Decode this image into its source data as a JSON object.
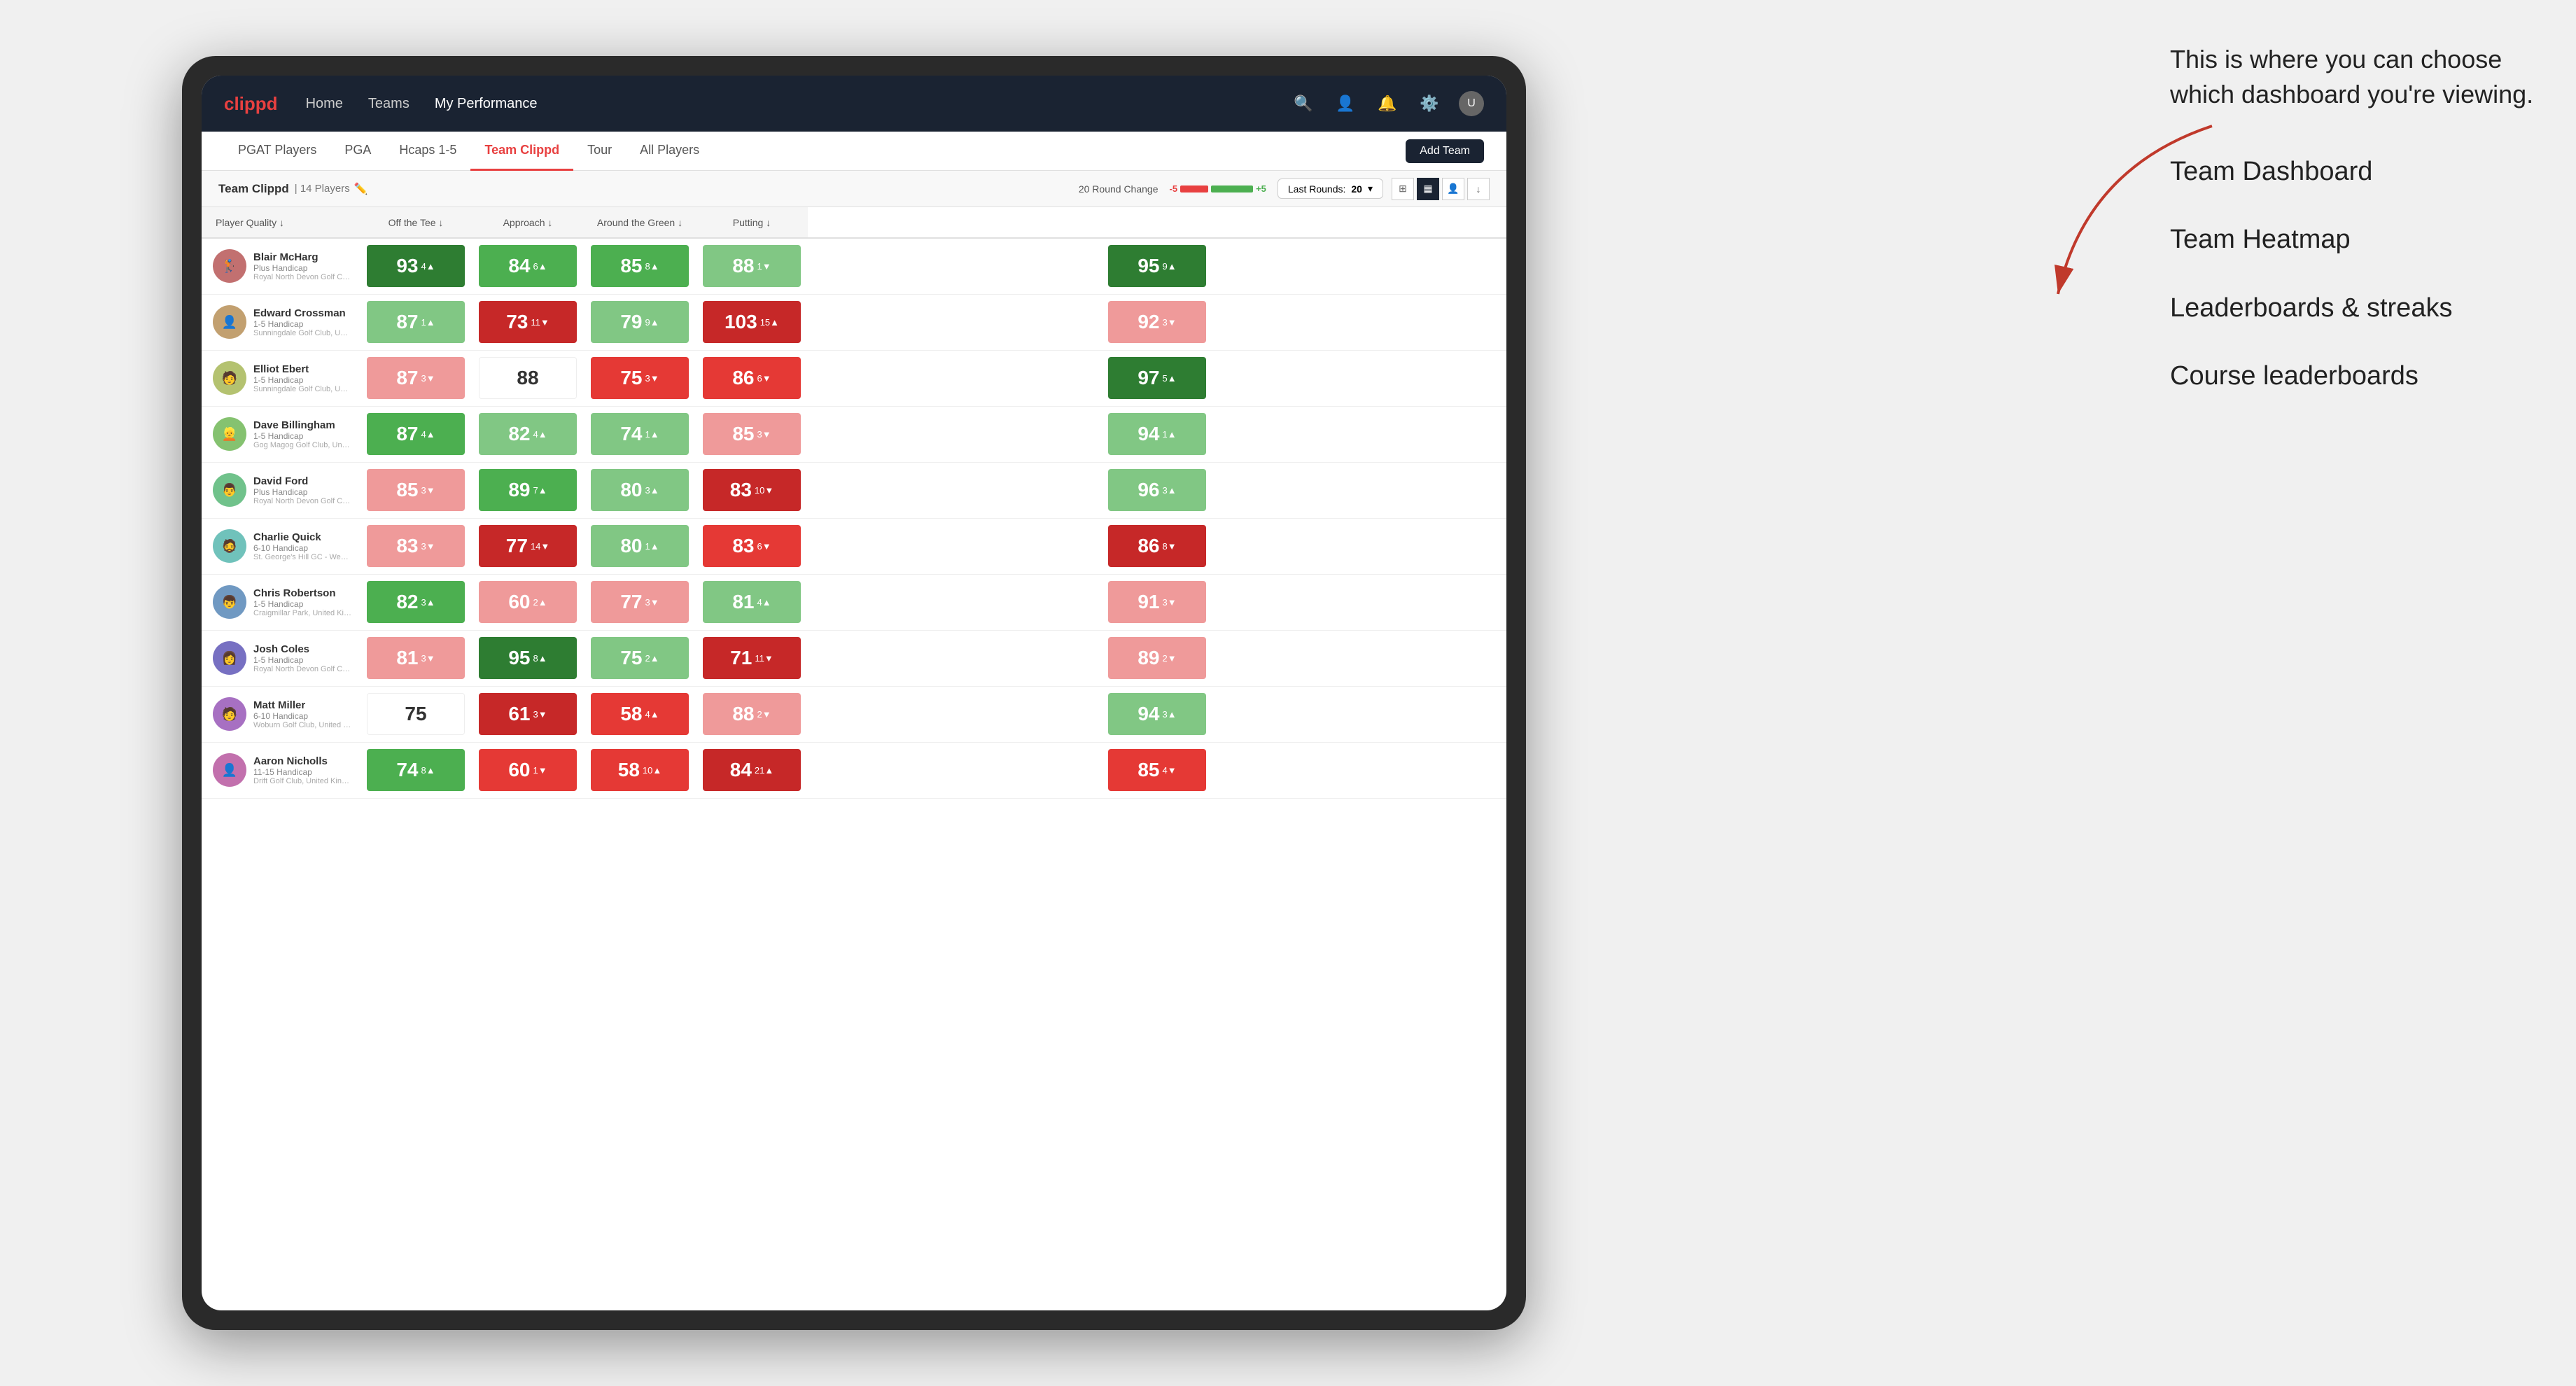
{
  "annotation": {
    "intro": "This is where you can choose which dashboard you're viewing.",
    "menu_items": [
      "Team Dashboard",
      "Team Heatmap",
      "Leaderboards & streaks",
      "Course leaderboards"
    ]
  },
  "nav": {
    "logo": "clippd",
    "items": [
      "Home",
      "Teams",
      "My Performance"
    ],
    "active": "My Performance"
  },
  "sub_nav": {
    "items": [
      "PGAT Players",
      "PGA",
      "Hcaps 1-5",
      "Team Clippd",
      "Tour",
      "All Players"
    ],
    "active": "Team Clippd",
    "add_team": "Add Team"
  },
  "team_header": {
    "title": "Team Clippd",
    "separator": "|",
    "count": "14 Players",
    "round_change_label": "20 Round Change",
    "round_neg": "-5",
    "round_pos": "+5",
    "last_rounds_label": "Last Rounds:",
    "last_rounds_value": "20"
  },
  "columns": {
    "player": "Player Quality ↓",
    "metrics": [
      "Off the Tee ↓",
      "Approach ↓",
      "Around the Green ↓",
      "Putting ↓"
    ]
  },
  "players": [
    {
      "name": "Blair McHarg",
      "hcp": "Plus Handicap",
      "club": "Royal North Devon Golf Club, United Kingdom",
      "scores": [
        {
          "val": "93",
          "change": "4▲",
          "color": "green-dark"
        },
        {
          "val": "84",
          "change": "6▲",
          "color": "green-mid"
        },
        {
          "val": "85",
          "change": "8▲",
          "color": "green-mid"
        },
        {
          "val": "88",
          "change": "1▼",
          "color": "green-light"
        },
        {
          "val": "95",
          "change": "9▲",
          "color": "green-dark"
        }
      ]
    },
    {
      "name": "Edward Crossman",
      "hcp": "1-5 Handicap",
      "club": "Sunningdale Golf Club, United Kingdom",
      "scores": [
        {
          "val": "87",
          "change": "1▲",
          "color": "green-light"
        },
        {
          "val": "73",
          "change": "11▼",
          "color": "red-dark"
        },
        {
          "val": "79",
          "change": "9▲",
          "color": "green-light"
        },
        {
          "val": "103",
          "change": "15▲",
          "color": "red-dark"
        },
        {
          "val": "92",
          "change": "3▼",
          "color": "red-light"
        }
      ]
    },
    {
      "name": "Elliot Ebert",
      "hcp": "1-5 Handicap",
      "club": "Sunningdale Golf Club, United Kingdom",
      "scores": [
        {
          "val": "87",
          "change": "3▼",
          "color": "red-light"
        },
        {
          "val": "88",
          "change": "",
          "color": "neutral"
        },
        {
          "val": "75",
          "change": "3▼",
          "color": "red-mid"
        },
        {
          "val": "86",
          "change": "6▼",
          "color": "red-mid"
        },
        {
          "val": "97",
          "change": "5▲",
          "color": "green-dark"
        }
      ]
    },
    {
      "name": "Dave Billingham",
      "hcp": "1-5 Handicap",
      "club": "Gog Magog Golf Club, United Kingdom",
      "scores": [
        {
          "val": "87",
          "change": "4▲",
          "color": "green-mid"
        },
        {
          "val": "82",
          "change": "4▲",
          "color": "green-light"
        },
        {
          "val": "74",
          "change": "1▲",
          "color": "green-light"
        },
        {
          "val": "85",
          "change": "3▼",
          "color": "red-light"
        },
        {
          "val": "94",
          "change": "1▲",
          "color": "green-light"
        }
      ]
    },
    {
      "name": "David Ford",
      "hcp": "Plus Handicap",
      "club": "Royal North Devon Golf Club, United Kingdom",
      "scores": [
        {
          "val": "85",
          "change": "3▼",
          "color": "red-light"
        },
        {
          "val": "89",
          "change": "7▲",
          "color": "green-mid"
        },
        {
          "val": "80",
          "change": "3▲",
          "color": "green-light"
        },
        {
          "val": "83",
          "change": "10▼",
          "color": "red-dark"
        },
        {
          "val": "96",
          "change": "3▲",
          "color": "green-light"
        }
      ]
    },
    {
      "name": "Charlie Quick",
      "hcp": "6-10 Handicap",
      "club": "St. George's Hill GC - Weybridge - Surrey, Uni...",
      "scores": [
        {
          "val": "83",
          "change": "3▼",
          "color": "red-light"
        },
        {
          "val": "77",
          "change": "14▼",
          "color": "red-dark"
        },
        {
          "val": "80",
          "change": "1▲",
          "color": "green-light"
        },
        {
          "val": "83",
          "change": "6▼",
          "color": "red-mid"
        },
        {
          "val": "86",
          "change": "8▼",
          "color": "red-dark"
        }
      ]
    },
    {
      "name": "Chris Robertson",
      "hcp": "1-5 Handicap",
      "club": "Craigmillar Park, United Kingdom",
      "scores": [
        {
          "val": "82",
          "change": "3▲",
          "color": "green-mid"
        },
        {
          "val": "60",
          "change": "2▲",
          "color": "red-light"
        },
        {
          "val": "77",
          "change": "3▼",
          "color": "red-light"
        },
        {
          "val": "81",
          "change": "4▲",
          "color": "green-light"
        },
        {
          "val": "91",
          "change": "3▼",
          "color": "red-light"
        }
      ]
    },
    {
      "name": "Josh Coles",
      "hcp": "1-5 Handicap",
      "club": "Royal North Devon Golf Club, United Kingdom",
      "scores": [
        {
          "val": "81",
          "change": "3▼",
          "color": "red-light"
        },
        {
          "val": "95",
          "change": "8▲",
          "color": "green-dark"
        },
        {
          "val": "75",
          "change": "2▲",
          "color": "green-light"
        },
        {
          "val": "71",
          "change": "11▼",
          "color": "red-dark"
        },
        {
          "val": "89",
          "change": "2▼",
          "color": "red-light"
        }
      ]
    },
    {
      "name": "Matt Miller",
      "hcp": "6-10 Handicap",
      "club": "Woburn Golf Club, United Kingdom",
      "scores": [
        {
          "val": "75",
          "change": "",
          "color": "neutral"
        },
        {
          "val": "61",
          "change": "3▼",
          "color": "red-dark"
        },
        {
          "val": "58",
          "change": "4▲",
          "color": "red-mid"
        },
        {
          "val": "88",
          "change": "2▼",
          "color": "red-light"
        },
        {
          "val": "94",
          "change": "3▲",
          "color": "green-light"
        }
      ]
    },
    {
      "name": "Aaron Nicholls",
      "hcp": "11-15 Handicap",
      "club": "Drift Golf Club, United Kingdom",
      "scores": [
        {
          "val": "74",
          "change": "8▲",
          "color": "green-mid"
        },
        {
          "val": "60",
          "change": "1▼",
          "color": "red-mid"
        },
        {
          "val": "58",
          "change": "10▲",
          "color": "red-mid"
        },
        {
          "val": "84",
          "change": "21▲",
          "color": "red-dark"
        },
        {
          "val": "85",
          "change": "4▼",
          "color": "red-mid"
        }
      ]
    }
  ]
}
